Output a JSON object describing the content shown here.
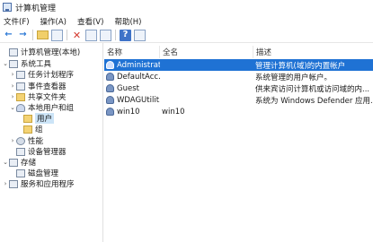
{
  "window": {
    "title": "计算机管理"
  },
  "menu": [
    "文件(F)",
    "操作(A)",
    "查看(V)",
    "帮助(H)"
  ],
  "toolbar": {
    "back": "←",
    "forward": "→",
    "delete": "✕",
    "help": "?"
  },
  "tree": [
    {
      "label": "计算机管理(本地)",
      "indent": 0,
      "twisty": "",
      "icon": "computer"
    },
    {
      "label": "系统工具",
      "indent": 1,
      "twisty": "⌄",
      "icon": "tools"
    },
    {
      "label": "任务计划程序",
      "indent": 2,
      "twisty": "›",
      "icon": "task"
    },
    {
      "label": "事件查看器",
      "indent": 2,
      "twisty": "›",
      "icon": "event"
    },
    {
      "label": "共享文件夹",
      "indent": 2,
      "twisty": "›",
      "icon": "folder"
    },
    {
      "label": "本地用户和组",
      "indent": 2,
      "twisty": "⌄",
      "icon": "users"
    },
    {
      "label": "用户",
      "indent": 3,
      "twisty": "",
      "icon": "folder",
      "selected": true
    },
    {
      "label": "组",
      "indent": 3,
      "twisty": "",
      "icon": "folder"
    },
    {
      "label": "性能",
      "indent": 2,
      "twisty": "›",
      "icon": "perf"
    },
    {
      "label": "设备管理器",
      "indent": 2,
      "twisty": "",
      "icon": "device"
    },
    {
      "label": "存储",
      "indent": 1,
      "twisty": "⌄",
      "icon": "storage"
    },
    {
      "label": "磁盘管理",
      "indent": 2,
      "twisty": "",
      "icon": "disk"
    },
    {
      "label": "服务和应用程序",
      "indent": 1,
      "twisty": "›",
      "icon": "services"
    }
  ],
  "list": {
    "headers": {
      "name": "名称",
      "fullname": "全名",
      "desc": "描述"
    },
    "rows": [
      {
        "name": "Administrat...",
        "fullname": "",
        "desc": "管理计算机(域)的内置帐户",
        "selected": true
      },
      {
        "name": "DefaultAcc...",
        "fullname": "",
        "desc": "系统管理的用户帐户。"
      },
      {
        "name": "Guest",
        "fullname": "",
        "desc": "供来宾访问计算机或访问域的内..."
      },
      {
        "name": "WDAGUtilit...",
        "fullname": "",
        "desc": "系统为 Windows Defender 应用..."
      },
      {
        "name": "win10",
        "fullname": "win10",
        "desc": ""
      }
    ]
  }
}
